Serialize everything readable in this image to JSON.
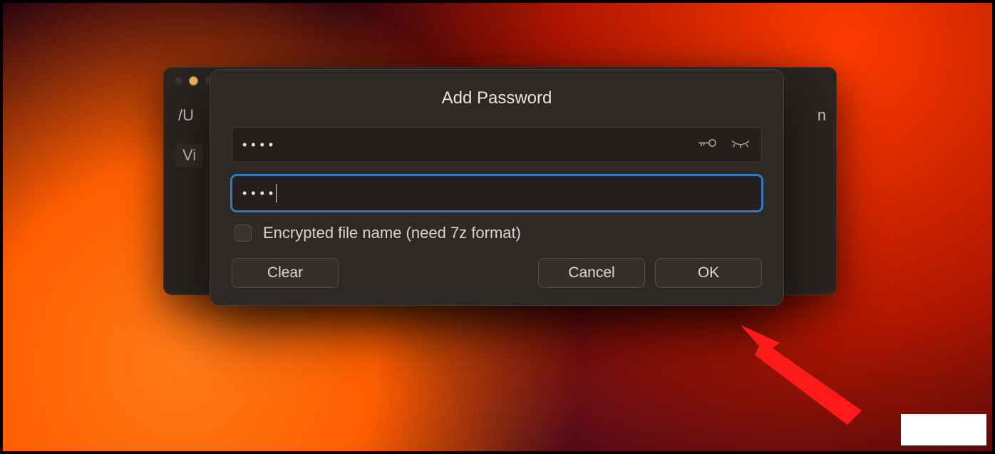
{
  "back_window": {
    "path_fragment": "/U",
    "left_tag": "Vi",
    "right_fragment": "n"
  },
  "dialog": {
    "title": "Add Password",
    "password_value": "••••",
    "confirm_value": "••••",
    "checkbox_label": "Encrypted file name (need 7z format)",
    "buttons": {
      "clear": "Clear",
      "cancel": "Cancel",
      "ok": "OK"
    }
  }
}
